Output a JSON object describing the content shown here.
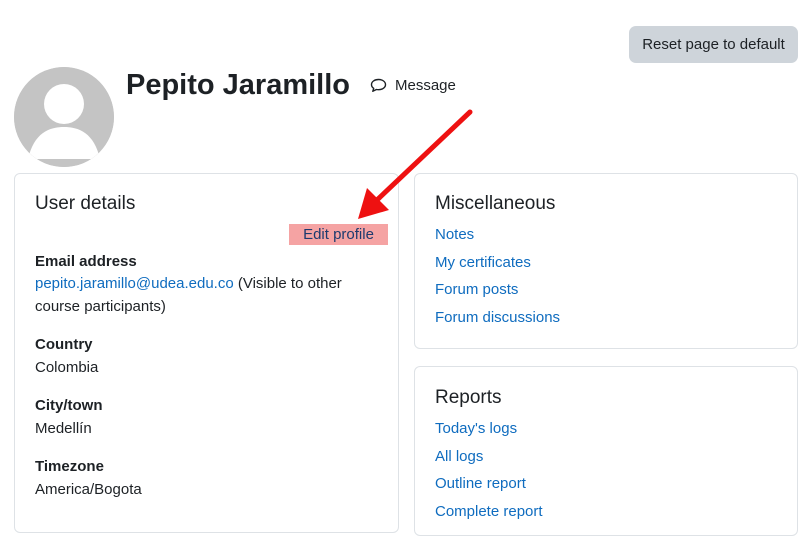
{
  "toolbar": {
    "reset_label": "Reset page to default"
  },
  "header": {
    "user_name": "Pepito Jaramillo",
    "message_label": "Message"
  },
  "user_details": {
    "title": "User details",
    "edit_profile_label": "Edit profile",
    "email": {
      "label": "Email address",
      "value": "pepito.jaramillo@udea.edu.co",
      "note": " (Visible to other course participants)"
    },
    "country": {
      "label": "Country",
      "value": "Colombia"
    },
    "city": {
      "label": "City/town",
      "value": "Medellín"
    },
    "timezone": {
      "label": "Timezone",
      "value": "America/Bogota"
    }
  },
  "misc": {
    "title": "Miscellaneous",
    "links": [
      "Notes",
      "My certificates",
      "Forum posts",
      "Forum discussions"
    ]
  },
  "reports": {
    "title": "Reports",
    "links": [
      "Today's logs",
      "All logs",
      "Outline report",
      "Complete report"
    ]
  },
  "colors": {
    "link": "#0f6cbf",
    "button_bg": "#ced4da",
    "highlight": "#f5a3a3",
    "annotation_arrow": "#ee1111"
  },
  "icons": {
    "avatar": "default-user-avatar",
    "message": "speech-bubble-icon",
    "annotation": "red-arrow-annotation"
  }
}
